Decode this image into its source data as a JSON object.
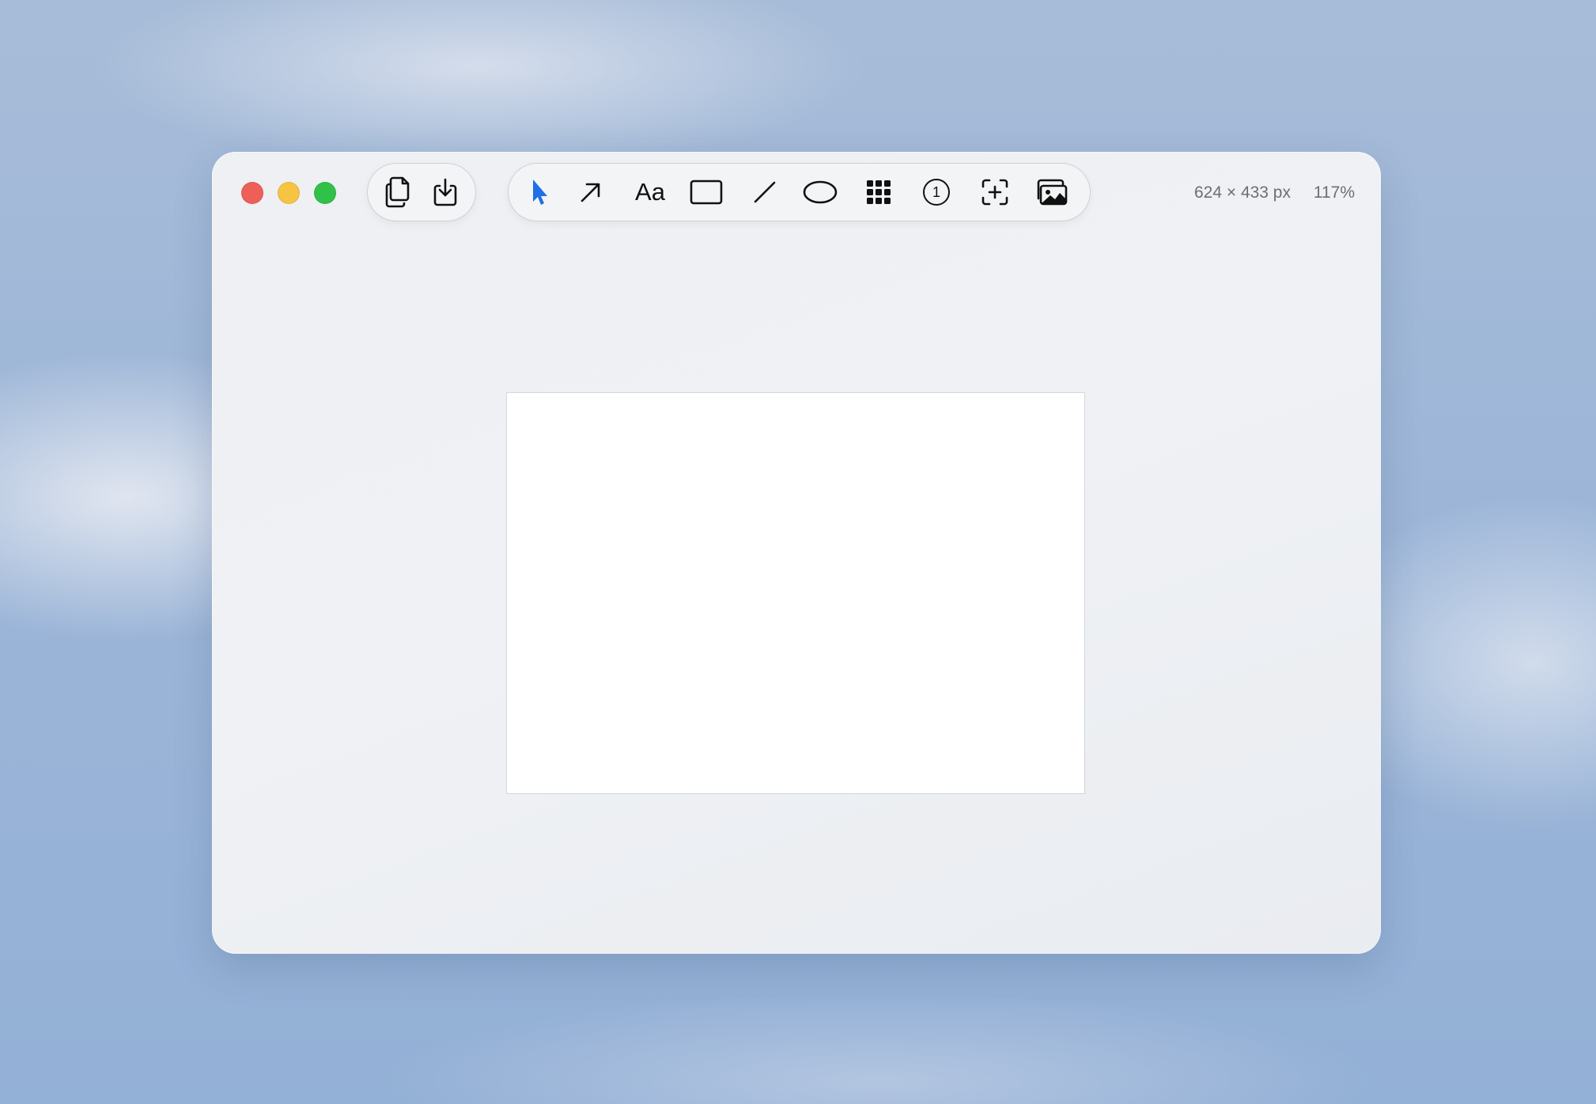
{
  "window": {
    "traffic_lights": [
      {
        "name": "close",
        "color": "#ee5f57"
      },
      {
        "name": "minimize",
        "color": "#f6c343"
      },
      {
        "name": "maximize",
        "color": "#31c048"
      }
    ]
  },
  "toolbar": {
    "file_actions": [
      {
        "name": "copy",
        "icon": "copy-icon"
      },
      {
        "name": "save",
        "icon": "download-icon"
      }
    ],
    "tools": [
      {
        "name": "select",
        "icon": "pointer-icon",
        "active": true
      },
      {
        "name": "arrow",
        "icon": "arrow-icon"
      },
      {
        "name": "text",
        "icon": "text-icon",
        "label": "Aa"
      },
      {
        "name": "rectangle",
        "icon": "rectangle-icon"
      },
      {
        "name": "line",
        "icon": "line-icon"
      },
      {
        "name": "ellipse",
        "icon": "ellipse-icon"
      },
      {
        "name": "pixelate",
        "icon": "grid-icon"
      },
      {
        "name": "counter",
        "icon": "numbered-circle-icon",
        "label": "1"
      },
      {
        "name": "crop",
        "icon": "crop-add-icon"
      },
      {
        "name": "background",
        "icon": "photos-icon"
      }
    ],
    "accent_color": "#1f6fe8"
  },
  "status": {
    "image_size": "624 × 433 px",
    "zoom": "117%"
  }
}
